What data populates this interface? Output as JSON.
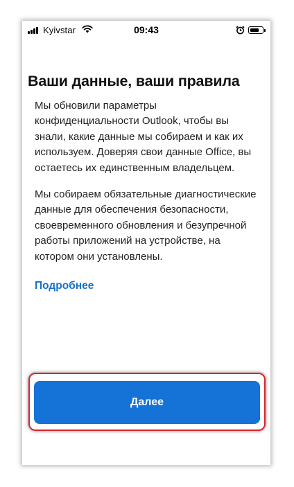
{
  "status_bar": {
    "carrier": "Kyivstar",
    "time": "09:43",
    "icons": [
      "signal-icon",
      "wifi-icon",
      "alarm-icon",
      "battery-icon"
    ],
    "battery_level": 0.8
  },
  "main": {
    "title": "Ваши данные, ваши правила",
    "paragraph_1": "Мы обновили параметры конфиденциальности Outlook, чтобы вы знали, какие данные мы собираем и как их используем. Доверяя свои данные Office, вы остаетесь их единственным владельцем.",
    "paragraph_2": "Мы собираем обязательные диагностические данные для обеспечения безопасности, своевременного обновления и безупречной работы приложений на устройстве, на котором они установлены.",
    "learn_more_link": "Подробнее"
  },
  "footer": {
    "next_button_label": "Далее"
  },
  "colors": {
    "accent": "#1572d6",
    "link": "#1572c7",
    "highlight_frame": "#d4262f"
  }
}
